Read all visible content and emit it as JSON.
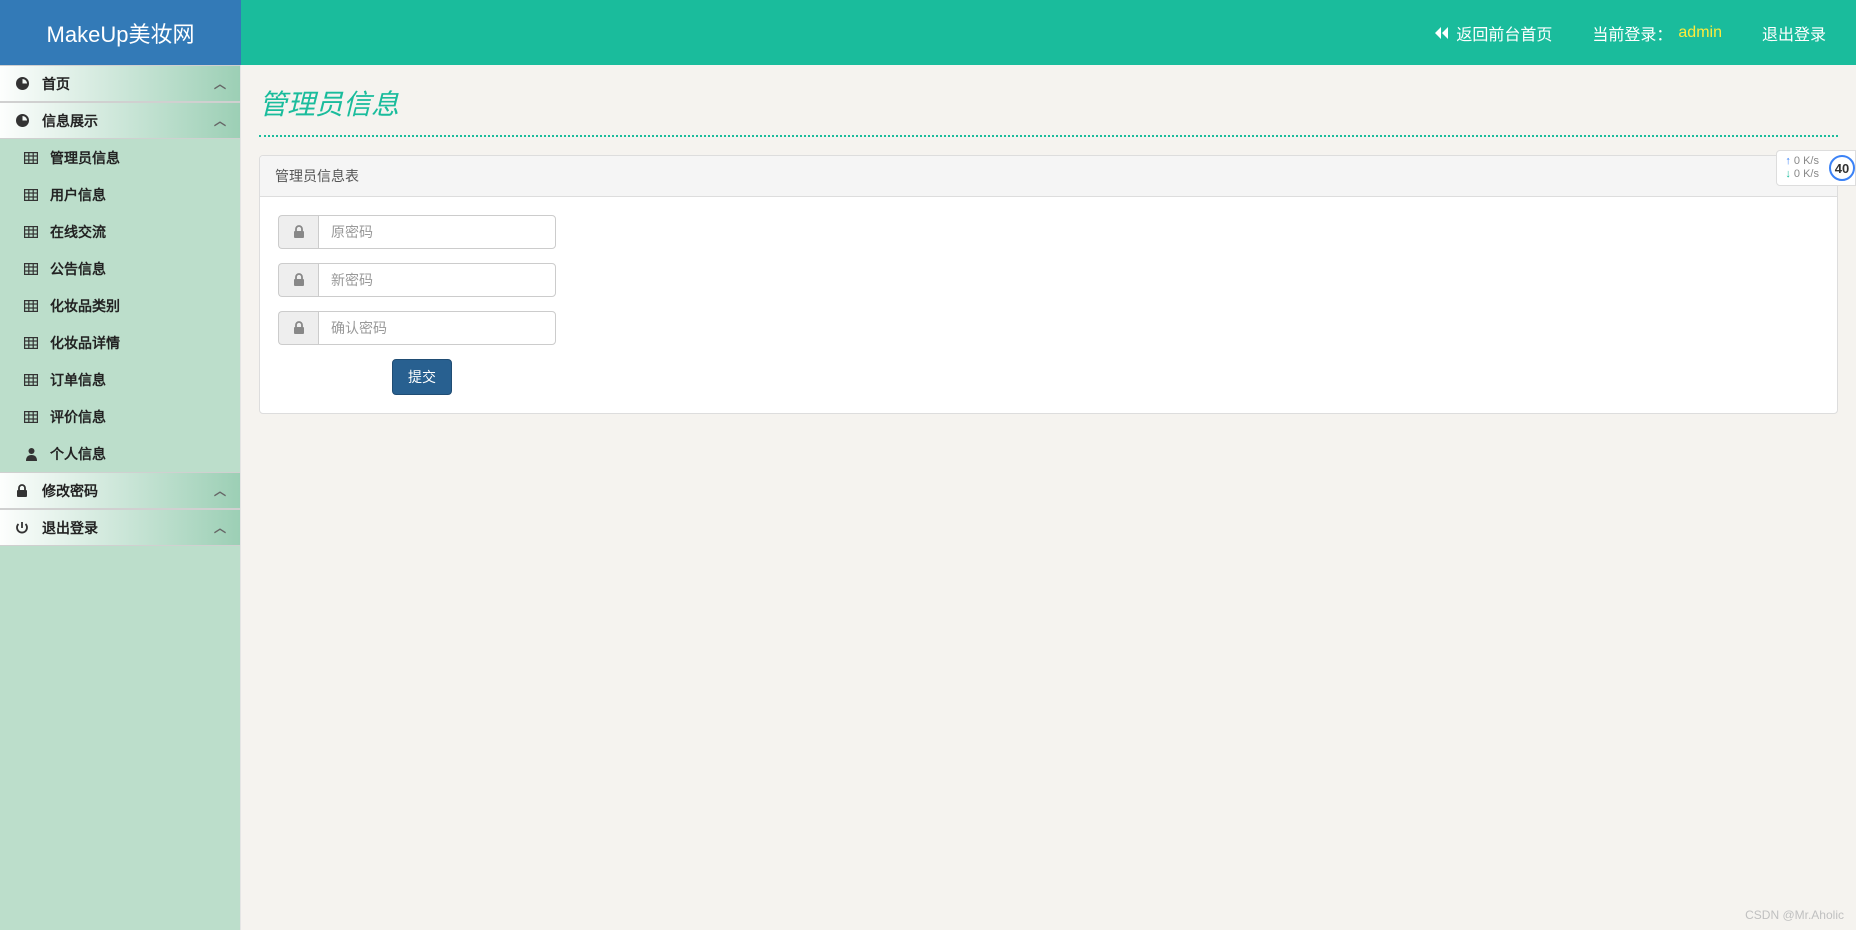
{
  "brand": "MakeUp美妆网",
  "topnav": {
    "back_home": "返回前台首页",
    "login_label": "当前登录：",
    "login_user": "admin",
    "logout": "退出登录"
  },
  "sidebar": {
    "home": "首页",
    "info_display": "信息展示",
    "sub": {
      "admin_info": "管理员信息",
      "user_info": "用户信息",
      "online_chat": "在线交流",
      "notice_info": "公告信息",
      "cosmetic_cat": "化妆品类别",
      "cosmetic_detail": "化妆品详情",
      "order_info": "订单信息",
      "review_info": "评价信息",
      "personal_info": "个人信息"
    },
    "change_pwd": "修改密码",
    "logout": "退出登录"
  },
  "page": {
    "title": "管理员信息",
    "panel_title": "管理员信息表",
    "old_pwd_ph": "原密码",
    "new_pwd_ph": "新密码",
    "confirm_pwd_ph": "确认密码",
    "submit": "提交"
  },
  "net": {
    "up": "0  K/s",
    "down": "0  K/s",
    "num": "40"
  },
  "watermark": "CSDN @Mr.Aholic"
}
